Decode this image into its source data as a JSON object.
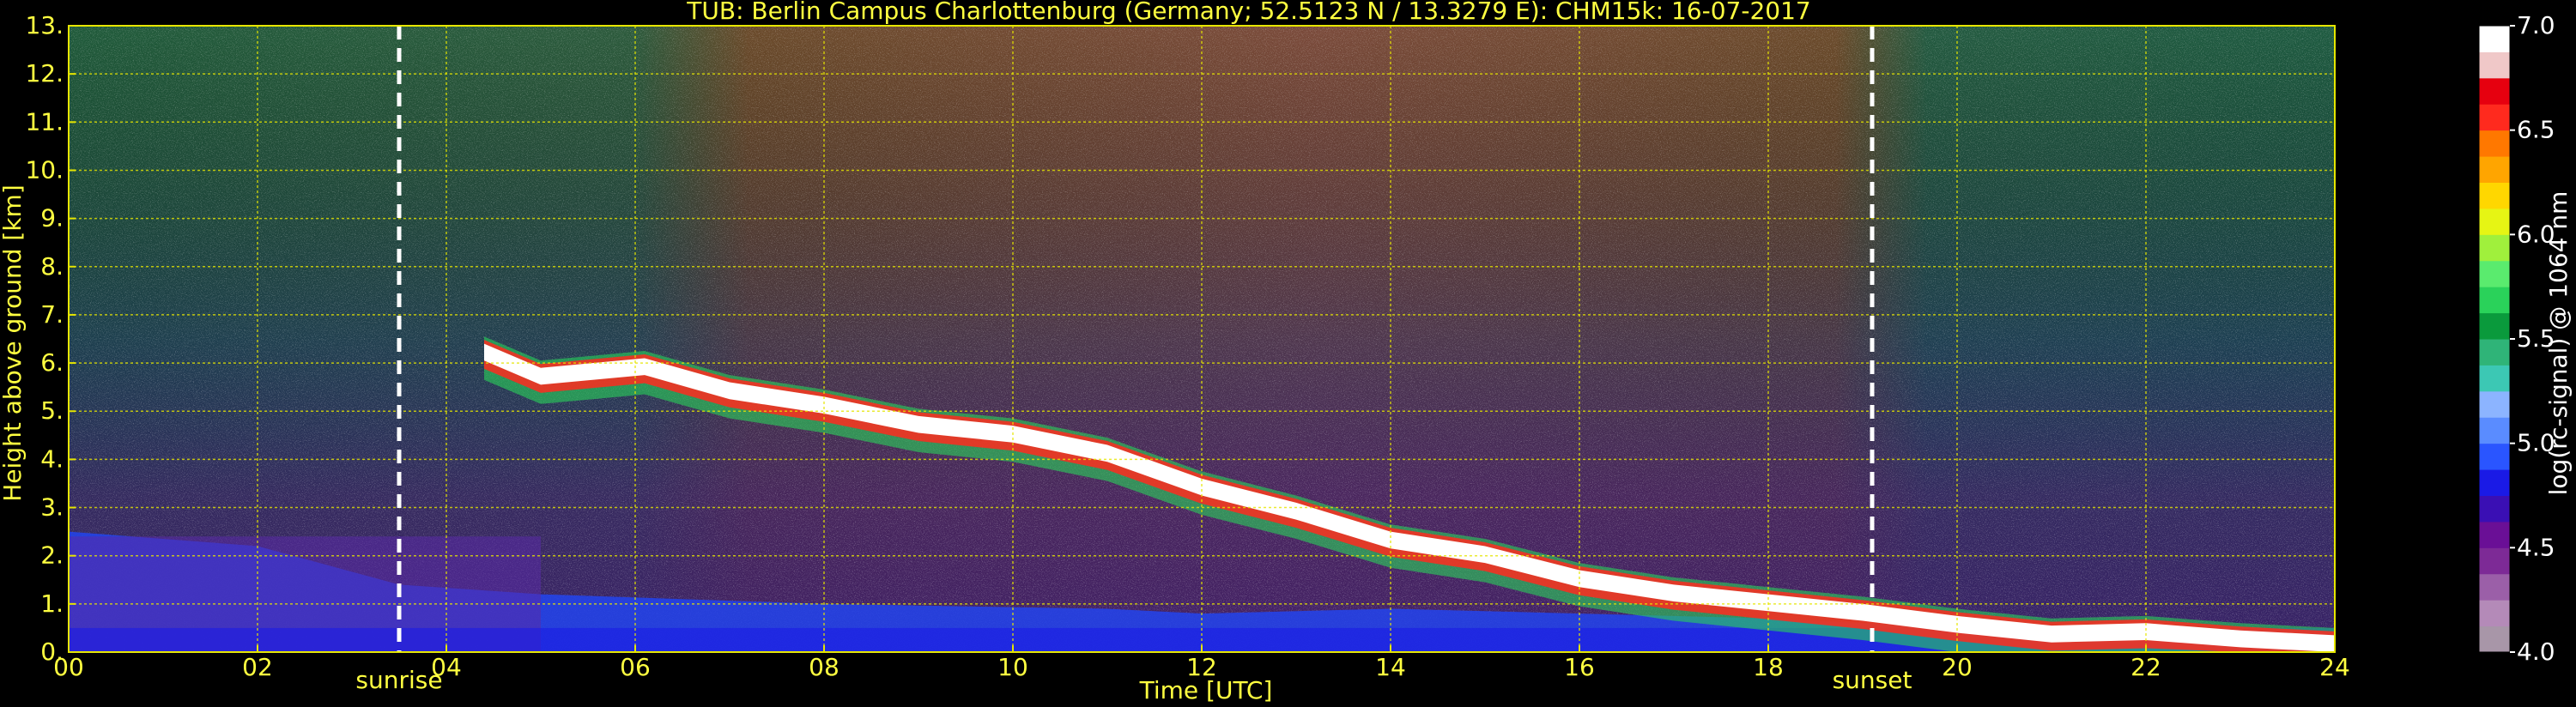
{
  "chart_data": {
    "type": "heatmap",
    "title": "TUB: Berlin Campus Charlottenburg (Germany; 52.5123 N / 13.3279 E):    CHM15k: 16-07-2017",
    "xlabel": "Time [UTC]",
    "ylabel": "Height above ground [km]",
    "xlim": [
      0,
      24
    ],
    "ylim": [
      0,
      13
    ],
    "x_ticks": [
      {
        "value": 0,
        "label": "00"
      },
      {
        "value": 2,
        "label": "02"
      },
      {
        "value": 4,
        "label": "04"
      },
      {
        "value": 6,
        "label": "06"
      },
      {
        "value": 8,
        "label": "08"
      },
      {
        "value": 10,
        "label": "10"
      },
      {
        "value": 12,
        "label": "12"
      },
      {
        "value": 14,
        "label": "14"
      },
      {
        "value": 16,
        "label": "16"
      },
      {
        "value": 18,
        "label": "18"
      },
      {
        "value": 20,
        "label": "20"
      },
      {
        "value": 22,
        "label": "22"
      },
      {
        "value": 24,
        "label": "24"
      }
    ],
    "y_ticks": [
      {
        "value": 0,
        "label": "0."
      },
      {
        "value": 1,
        "label": "1."
      },
      {
        "value": 2,
        "label": "2."
      },
      {
        "value": 3,
        "label": "3."
      },
      {
        "value": 4,
        "label": "4."
      },
      {
        "value": 5,
        "label": "5."
      },
      {
        "value": 6,
        "label": "6."
      },
      {
        "value": 7,
        "label": "7."
      },
      {
        "value": 8,
        "label": "8."
      },
      {
        "value": 9,
        "label": "9."
      },
      {
        "value": 10,
        "label": "10."
      },
      {
        "value": 11,
        "label": "11."
      },
      {
        "value": 12,
        "label": "12."
      },
      {
        "value": 13,
        "label": "13."
      }
    ],
    "grid": true,
    "annotations": [
      {
        "label": "sunrise",
        "x": 3.5
      },
      {
        "label": "sunset",
        "x": 19.1
      }
    ],
    "colorbar": {
      "label": "log(rc-signal) @ 1064 nm",
      "range": [
        4.0,
        7.0
      ],
      "ticks": [
        {
          "value": 4.0,
          "label": "4.0"
        },
        {
          "value": 4.5,
          "label": "4.5"
        },
        {
          "value": 5.0,
          "label": "5.0"
        },
        {
          "value": 5.5,
          "label": "5.5"
        },
        {
          "value": 6.0,
          "label": "6.0"
        },
        {
          "value": 6.5,
          "label": "6.5"
        },
        {
          "value": 7.0,
          "label": "7.0"
        }
      ],
      "colors": [
        "#a896a8",
        "#b48ab8",
        "#9b5fa8",
        "#7d2a96",
        "#6a0f96",
        "#3a0fb4",
        "#1a1ae6",
        "#2a55ff",
        "#5a8cff",
        "#8cb4ff",
        "#3cc8b4",
        "#2fb478",
        "#0a9a3c",
        "#2ad25a",
        "#5aeb6e",
        "#a0f03c",
        "#e6f514",
        "#ffd700",
        "#ffa500",
        "#ff7800",
        "#ff2a1e",
        "#e6000f",
        "#f0c8c8",
        "#ffffff"
      ]
    },
    "cloud_layer_top_km": [
      [
        4.4,
        6.4
      ],
      [
        5.0,
        5.9
      ],
      [
        6.1,
        6.1
      ],
      [
        7.0,
        5.6
      ],
      [
        8.0,
        5.3
      ],
      [
        9.0,
        4.9
      ],
      [
        10.0,
        4.7
      ],
      [
        11.0,
        4.3
      ],
      [
        12.0,
        3.6
      ],
      [
        13.0,
        3.1
      ],
      [
        14.0,
        2.5
      ],
      [
        15.0,
        2.2
      ],
      [
        16.0,
        1.7
      ],
      [
        17.0,
        1.4
      ],
      [
        18.0,
        1.2
      ],
      [
        19.0,
        1.0
      ],
      [
        20.0,
        0.75
      ],
      [
        21.0,
        0.55
      ],
      [
        22.0,
        0.6
      ],
      [
        23.0,
        0.45
      ],
      [
        24.0,
        0.35
      ]
    ],
    "boundary_layer_top_km": [
      [
        0,
        2.5
      ],
      [
        2,
        2.2
      ],
      [
        3.5,
        1.4
      ],
      [
        5,
        1.2
      ],
      [
        8,
        1.0
      ],
      [
        11,
        0.9
      ],
      [
        12,
        0.8
      ],
      [
        14,
        0.9
      ],
      [
        16,
        0.8
      ],
      [
        18,
        0.7
      ],
      [
        20,
        0.5
      ],
      [
        22,
        0.4
      ],
      [
        24,
        0.3
      ]
    ]
  }
}
